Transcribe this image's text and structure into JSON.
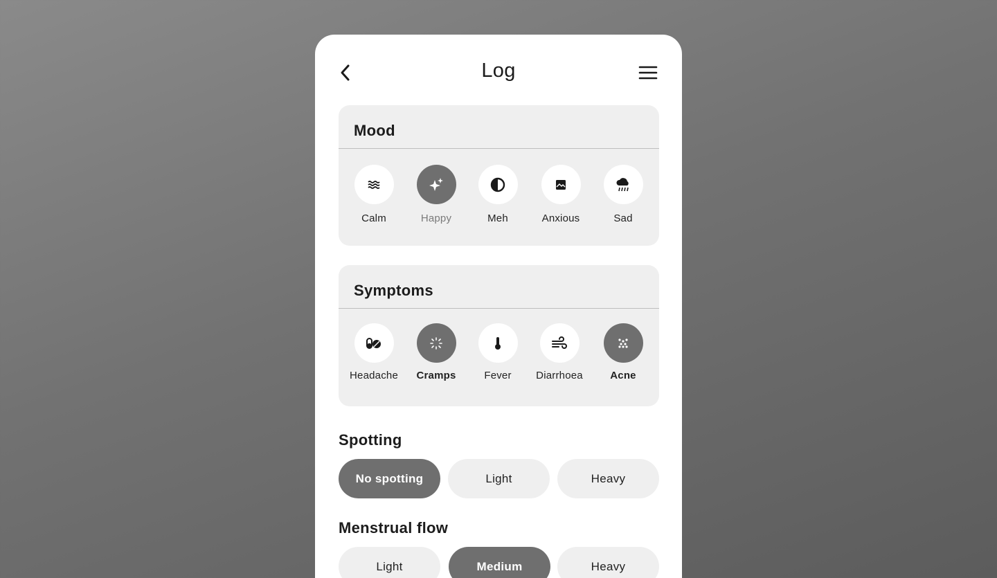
{
  "header": {
    "title": "Log",
    "back_icon": "chevron-left-icon",
    "menu_icon": "hamburger-menu-icon"
  },
  "mood": {
    "title": "Mood",
    "options": [
      {
        "label": "Calm",
        "icon": "waves-icon",
        "selected": false
      },
      {
        "label": "Happy",
        "icon": "sparkles-icon",
        "selected": true
      },
      {
        "label": "Meh",
        "icon": "half-circle-icon",
        "selected": false
      },
      {
        "label": "Anxious",
        "icon": "image-frame-icon",
        "selected": false
      },
      {
        "label": "Sad",
        "icon": "rain-cloud-icon",
        "selected": false
      }
    ]
  },
  "symptoms": {
    "title": "Symptoms",
    "options": [
      {
        "label": "Headache",
        "icon": "pills-icon",
        "selected": false
      },
      {
        "label": "Cramps",
        "icon": "burst-icon",
        "selected": true
      },
      {
        "label": "Fever",
        "icon": "thermometer-icon",
        "selected": false
      },
      {
        "label": "Diarrhoea",
        "icon": "wind-icon",
        "selected": false
      },
      {
        "label": "Acne",
        "icon": "dots-grid-icon",
        "selected": true
      }
    ]
  },
  "spotting": {
    "title": "Spotting",
    "options": [
      {
        "label": "No spotting",
        "selected": true
      },
      {
        "label": "Light",
        "selected": false
      },
      {
        "label": "Heavy",
        "selected": false
      }
    ]
  },
  "flow": {
    "title": "Menstrual flow",
    "options": [
      {
        "label": "Light",
        "selected": false
      },
      {
        "label": "Medium",
        "selected": true
      },
      {
        "label": "Heavy",
        "selected": false
      }
    ]
  },
  "colors": {
    "accent": "#6f6f6f",
    "card_bg": "#efefef",
    "text": "#1c1c1c"
  }
}
